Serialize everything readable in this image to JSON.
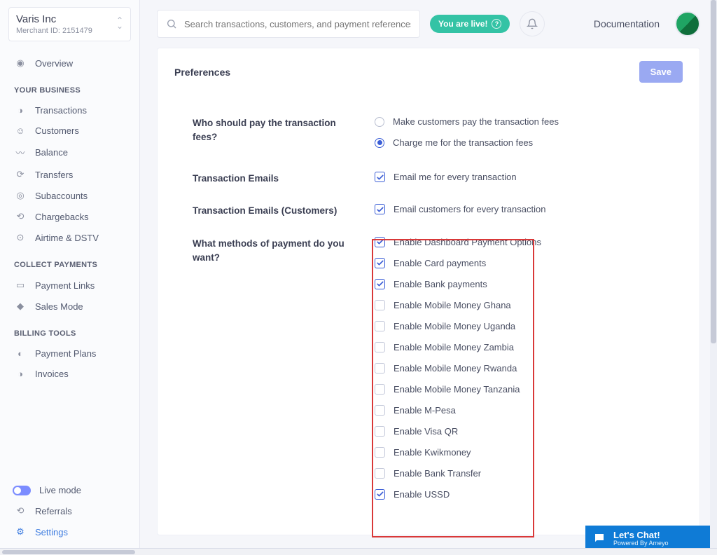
{
  "merchant": {
    "name": "Varis Inc",
    "id_label": "Merchant ID: 2151479"
  },
  "sidebar": {
    "overview": "Overview",
    "section_business": "YOUR BUSINESS",
    "business": [
      "Transactions",
      "Customers",
      "Balance",
      "Transfers",
      "Subaccounts",
      "Chargebacks",
      "Airtime & DSTV"
    ],
    "section_collect": "COLLECT PAYMENTS",
    "collect": [
      "Payment Links",
      "Sales Mode"
    ],
    "section_billing": "BILLING TOOLS",
    "billing": [
      "Payment Plans",
      "Invoices"
    ],
    "footer": {
      "live": "Live mode",
      "referrals": "Referrals",
      "settings": "Settings"
    }
  },
  "topbar": {
    "search_placeholder": "Search transactions, customers, and payment references.",
    "live_badge": "You are live!",
    "documentation": "Documentation"
  },
  "pref": {
    "title": "Preferences",
    "save": "Save",
    "q_fees": "Who should pay the transaction fees?",
    "fees_opts": [
      {
        "label": "Make customers pay the transaction fees",
        "selected": false
      },
      {
        "label": "Charge me for the transaction fees",
        "selected": true
      }
    ],
    "q_emails": "Transaction Emails",
    "emails_opt": {
      "label": "Email me for every transaction",
      "checked": true
    },
    "q_emails_cust": "Transaction Emails (Customers)",
    "emails_cust_opt": {
      "label": "Email customers for every transaction",
      "checked": true
    },
    "q_methods": "What methods of payment do you want?",
    "methods": [
      {
        "label": "Enable Dashboard Payment Options",
        "checked": true
      },
      {
        "label": "Enable Card payments",
        "checked": true
      },
      {
        "label": "Enable Bank payments",
        "checked": true
      },
      {
        "label": "Enable Mobile Money Ghana",
        "checked": false
      },
      {
        "label": "Enable Mobile Money Uganda",
        "checked": false
      },
      {
        "label": "Enable Mobile Money Zambia",
        "checked": false
      },
      {
        "label": "Enable Mobile Money Rwanda",
        "checked": false
      },
      {
        "label": "Enable Mobile Money Tanzania",
        "checked": false
      },
      {
        "label": "Enable M-Pesa",
        "checked": false
      },
      {
        "label": "Enable Visa QR",
        "checked": false
      },
      {
        "label": "Enable Kwikmoney",
        "checked": false
      },
      {
        "label": "Enable Bank Transfer",
        "checked": false
      },
      {
        "label": "Enable USSD",
        "checked": true
      }
    ]
  },
  "chat": {
    "title": "Let's Chat!",
    "sub": "Powered By Ameyo"
  }
}
